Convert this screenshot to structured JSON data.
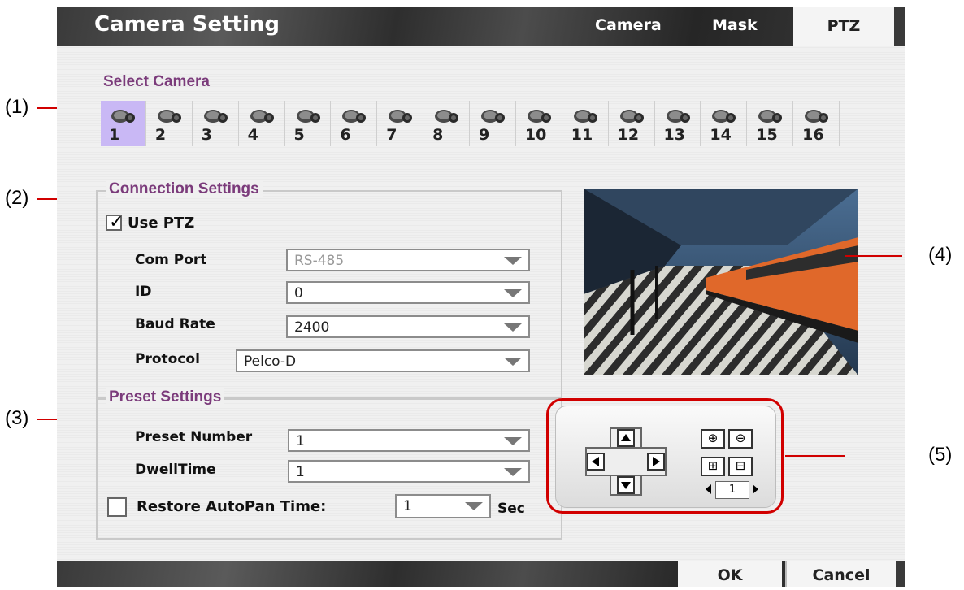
{
  "callouts": [
    "(1)",
    "(2)",
    "(3)",
    "(4)",
    "(5)"
  ],
  "title": "Camera Setting",
  "tabs": {
    "camera": "Camera",
    "mask": "Mask",
    "ptz": "PTZ"
  },
  "select_camera": {
    "heading": "Select Camera",
    "selected": "1",
    "cameras": [
      "1",
      "2",
      "3",
      "4",
      "5",
      "6",
      "7",
      "8",
      "9",
      "10",
      "11",
      "12",
      "13",
      "14",
      "15",
      "16"
    ]
  },
  "connection": {
    "heading": "Connection Settings",
    "use_ptz_label": "Use PTZ",
    "use_ptz_checked": true,
    "com_port_label": "Com Port",
    "com_port_value": "RS-485",
    "id_label": "ID",
    "id_value": "0",
    "baud_label": "Baud Rate",
    "baud_value": "2400",
    "protocol_label": "Protocol",
    "protocol_value": "Pelco-D"
  },
  "preset": {
    "heading": "Preset Settings",
    "preset_number_label": "Preset Number",
    "preset_number_value": "1",
    "dwell_label": "DwellTime",
    "dwell_value": "1",
    "restore_label": "Restore AutoPan Time:",
    "restore_checked": false,
    "restore_value": "1",
    "restore_unit": "Sec"
  },
  "ptz_pad": {
    "speed_value": "1"
  },
  "buttons": {
    "ok": "OK",
    "cancel": "Cancel"
  },
  "colors": {
    "accent_heading": "#7b3b7b",
    "callout_line": "#d10000",
    "selected_camera": "#c9b8f5"
  }
}
